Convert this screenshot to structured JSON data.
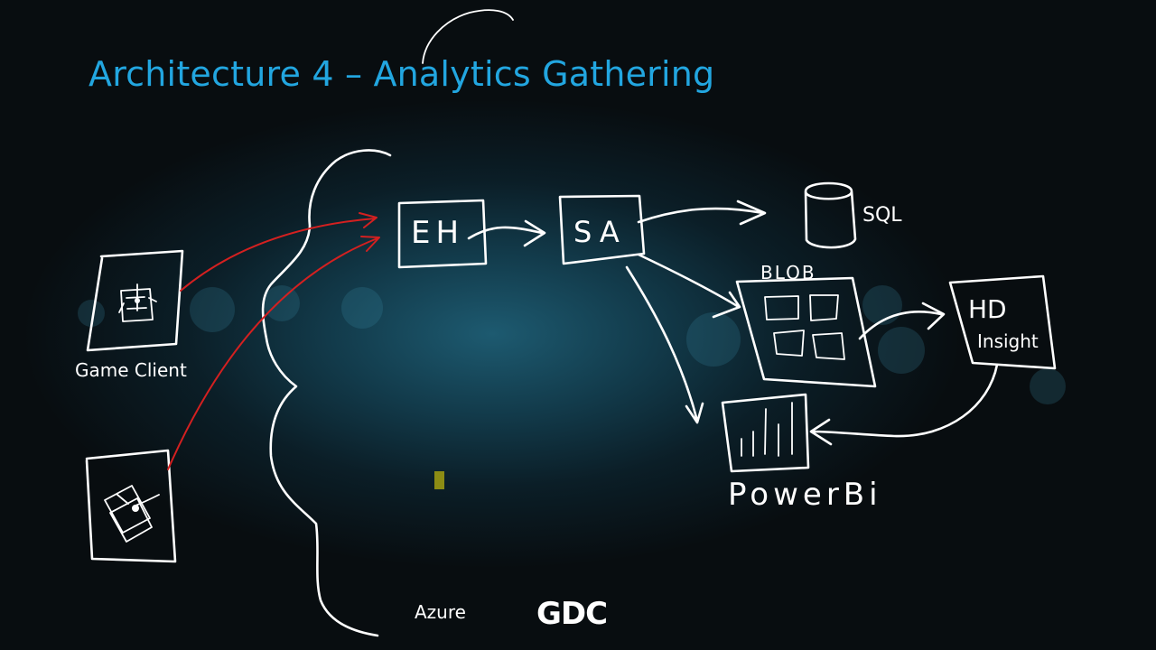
{
  "slide": {
    "title": "Architecture 4 – Analytics Gathering",
    "footer_left": "Azure",
    "footer_logo": "GDC"
  },
  "diagram": {
    "nodes": {
      "game_client_label": "Game Client",
      "eh": "EH",
      "sa": "SA",
      "sql": "SQL",
      "blob": "BLOB",
      "hd": "HD",
      "insight": "Insight",
      "powerbi": "PowerBi"
    }
  },
  "colors": {
    "title": "#22a6e0",
    "ink": "#ffffff",
    "client_arrows": "#d42020",
    "background_glow": "#1d5a70"
  }
}
